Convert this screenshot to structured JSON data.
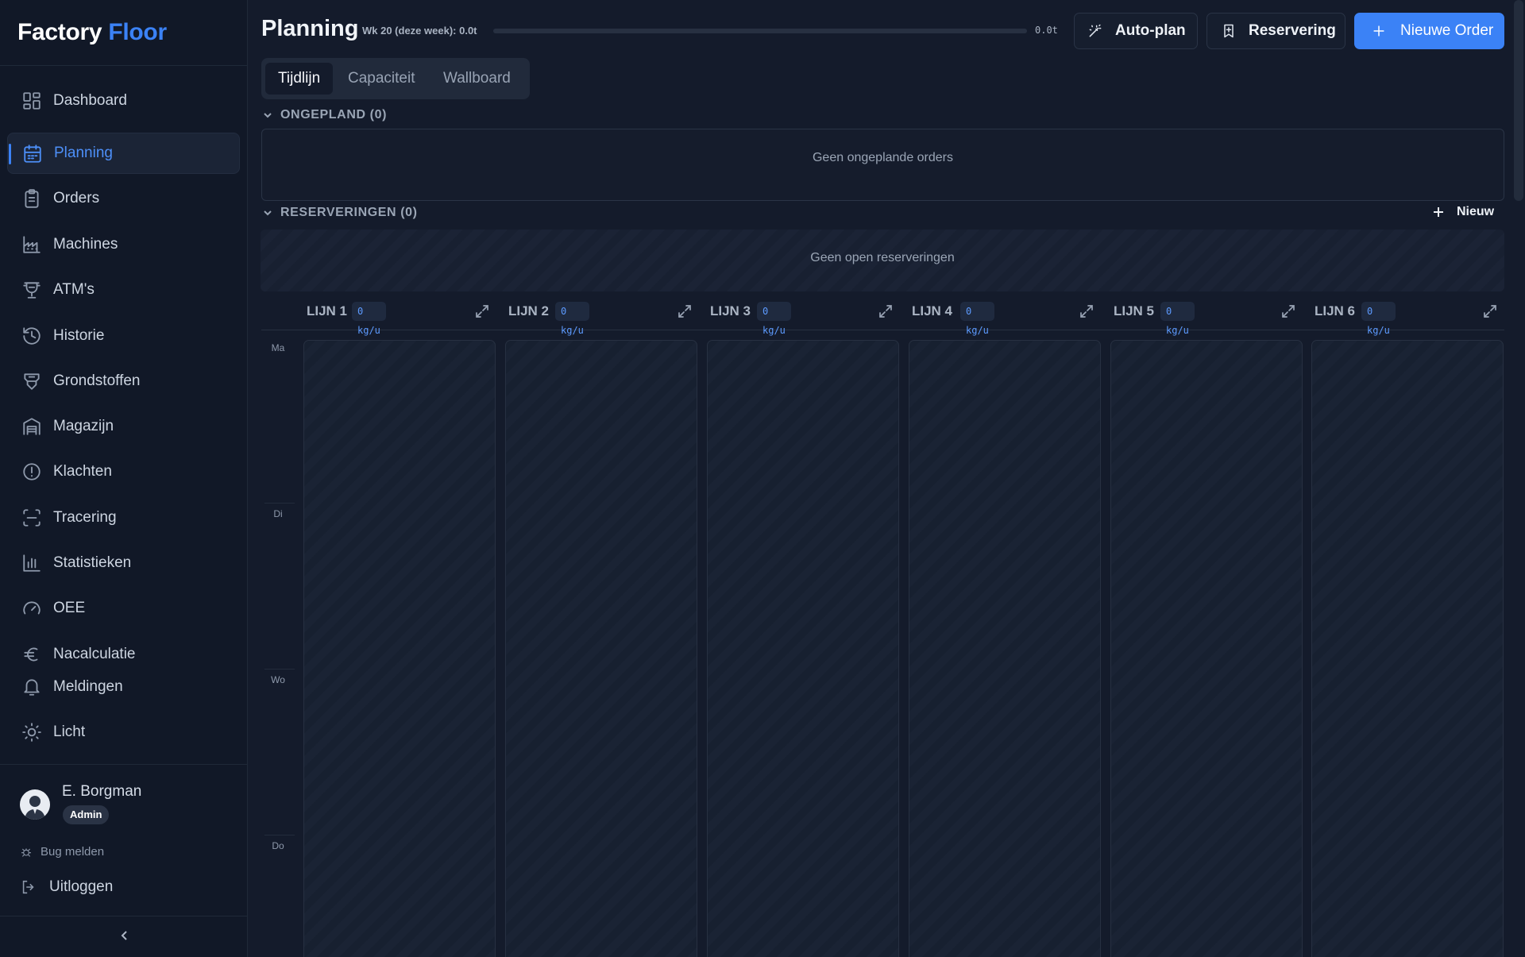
{
  "brand": {
    "part1": "Factory",
    "part2": "Floor"
  },
  "nav": [
    {
      "label": "Dashboard",
      "icon": "dashboard-icon"
    },
    {
      "label": "Planning",
      "icon": "calendar-icon",
      "active": true
    },
    {
      "label": "Orders",
      "icon": "clipboard-icon"
    },
    {
      "label": "Machines",
      "icon": "factory-icon"
    },
    {
      "label": "ATM's",
      "icon": "trophy-icon"
    },
    {
      "label": "Historie",
      "icon": "history-icon"
    },
    {
      "label": "Grondstoffen",
      "icon": "feed-icon"
    },
    {
      "label": "Magazijn",
      "icon": "warehouse-icon"
    },
    {
      "label": "Klachten",
      "icon": "alert-circle-icon"
    },
    {
      "label": "Tracering",
      "icon": "scan-icon"
    },
    {
      "label": "Statistieken",
      "icon": "bar-chart-icon"
    },
    {
      "label": "OEE",
      "icon": "gauge-icon"
    },
    {
      "label": "Nacalculatie",
      "icon": "euro-icon"
    },
    {
      "label": "Meldingen",
      "icon": "bell-icon"
    },
    {
      "label": "Licht",
      "icon": "sun-icon"
    }
  ],
  "user": {
    "name": "E. Borgman",
    "role": "Admin"
  },
  "footer": {
    "bug": "Bug melden",
    "logout": "Uitloggen"
  },
  "header": {
    "title": "Planning",
    "week_text": "Wk 20 (deze week): 0.0t",
    "progress_value": "0.0t",
    "progress_fraction": 0,
    "auto_plan": "Auto-plan",
    "reservation": "Reservering",
    "new_order": "Nieuwe Order"
  },
  "tabs": [
    {
      "label": "Tijdlijn",
      "active": true
    },
    {
      "label": "Capaciteit"
    },
    {
      "label": "Wallboard"
    }
  ],
  "unplanned": {
    "title": "ONGEPLAND (0)",
    "empty": "Geen ongeplande orders"
  },
  "reservations": {
    "title": "RESERVERINGEN (0)",
    "new_label": "Nieuw",
    "empty": "Geen open reserveringen"
  },
  "lines": [
    {
      "name": "LIJN 1",
      "rate": "0 kg/u"
    },
    {
      "name": "LIJN 2",
      "rate": "0 kg/u"
    },
    {
      "name": "LIJN 3",
      "rate": "0 kg/u"
    },
    {
      "name": "LIJN 4",
      "rate": "0 kg/u"
    },
    {
      "name": "LIJN 5",
      "rate": "0 kg/u"
    },
    {
      "name": "LIJN 6",
      "rate": "0 kg/u"
    }
  ],
  "days": [
    "Ma",
    "Di",
    "Wo",
    "Do"
  ],
  "colors": {
    "accent": "#3b82f6",
    "background": "#141b2b",
    "sidebar": "#111827"
  }
}
